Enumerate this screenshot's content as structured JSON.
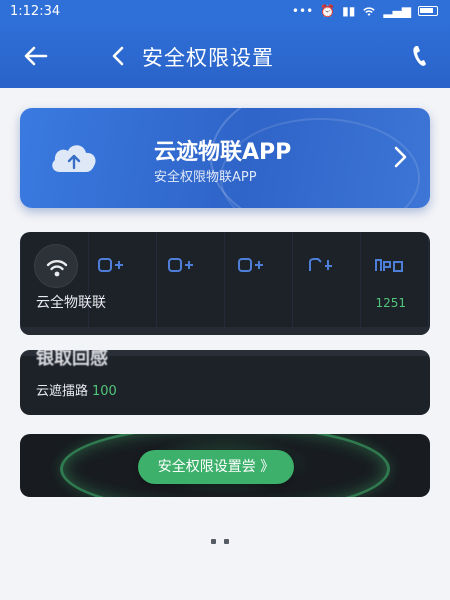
{
  "status_bar": {
    "time": "1:12:34",
    "dots": "•••"
  },
  "header": {
    "title": "安全权限设置"
  },
  "app_card": {
    "name": "云迹物联APP",
    "subtitle": "安全权限物联APP"
  },
  "panel_1": {
    "label": "云全物联联",
    "value": "1251"
  },
  "panel_2": {
    "title": "银取回感",
    "label": "云遮擂路",
    "number": "100"
  },
  "panel_3": {
    "button_label": "安全权限设置尝 》"
  },
  "colors": {
    "primary_blue": "#2f6fd8",
    "green_accent": "#3db06b",
    "dark_panel": "#1d2128"
  }
}
